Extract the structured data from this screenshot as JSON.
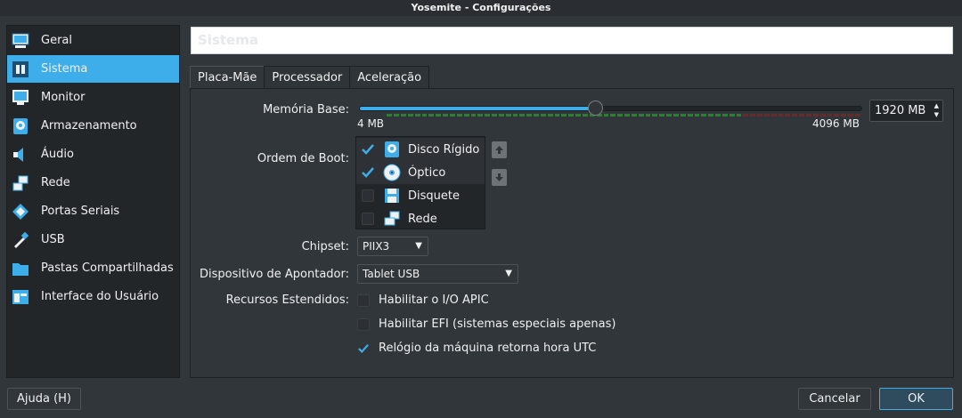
{
  "window": {
    "title": "Yosemite - Configurações"
  },
  "sidebar": {
    "items": [
      {
        "label": "Geral",
        "icon": "monitor-icon"
      },
      {
        "label": "Sistema",
        "icon": "chip-icon",
        "active": true
      },
      {
        "label": "Monitor",
        "icon": "display-icon"
      },
      {
        "label": "Armazenamento",
        "icon": "storage-icon"
      },
      {
        "label": "Áudio",
        "icon": "speaker-icon"
      },
      {
        "label": "Rede",
        "icon": "network-icon"
      },
      {
        "label": "Portas Seriais",
        "icon": "serial-port-icon"
      },
      {
        "label": "USB",
        "icon": "usb-icon"
      },
      {
        "label": "Pastas Compartilhadas",
        "icon": "folder-icon"
      },
      {
        "label": "Interface do Usuário",
        "icon": "ui-window-icon"
      }
    ]
  },
  "header": {
    "title": "Sistema"
  },
  "tabs": [
    {
      "label": "Placa-Mãe",
      "active": true
    },
    {
      "label": "Processador"
    },
    {
      "label": "Aceleração"
    }
  ],
  "motherboard": {
    "memory": {
      "label": "Memória Base:",
      "value": 1920,
      "min": 4,
      "max": 4096,
      "min_label": "4 MB",
      "max_label": "4096 MB",
      "value_text": "1920 MB"
    },
    "boot": {
      "label": "Ordem de Boot:",
      "items": [
        {
          "label": "Disco Rígido",
          "checked": true,
          "icon": "hard-disk-icon"
        },
        {
          "label": "Óptico",
          "checked": true,
          "icon": "optical-disc-icon"
        },
        {
          "label": "Disquete",
          "checked": false,
          "icon": "floppy-icon"
        },
        {
          "label": "Rede",
          "checked": false,
          "icon": "network-icon"
        }
      ]
    },
    "chipset": {
      "label": "Chipset:",
      "value": "PIIX3"
    },
    "pointing": {
      "label": "Dispositivo de Apontador:",
      "value": "Tablet USB"
    },
    "extended": {
      "label": "Recursos Estendidos:",
      "items": [
        {
          "label": "Habilitar o I/O APIC",
          "checked": false
        },
        {
          "label": "Habilitar EFI (sistemas especiais apenas)",
          "checked": false
        },
        {
          "label": "Relógio da máquina retorna hora UTC",
          "checked": true
        }
      ]
    }
  },
  "footer": {
    "help_label": "Ajuda (H)",
    "cancel_label": "Cancelar",
    "ok_label": "OK"
  },
  "colors": {
    "accent": "#3daee9",
    "background": "#31363b",
    "sidebar_bg": "#232629",
    "tick_green": "#2e7d32",
    "tick_red": "#6b2a2a"
  }
}
